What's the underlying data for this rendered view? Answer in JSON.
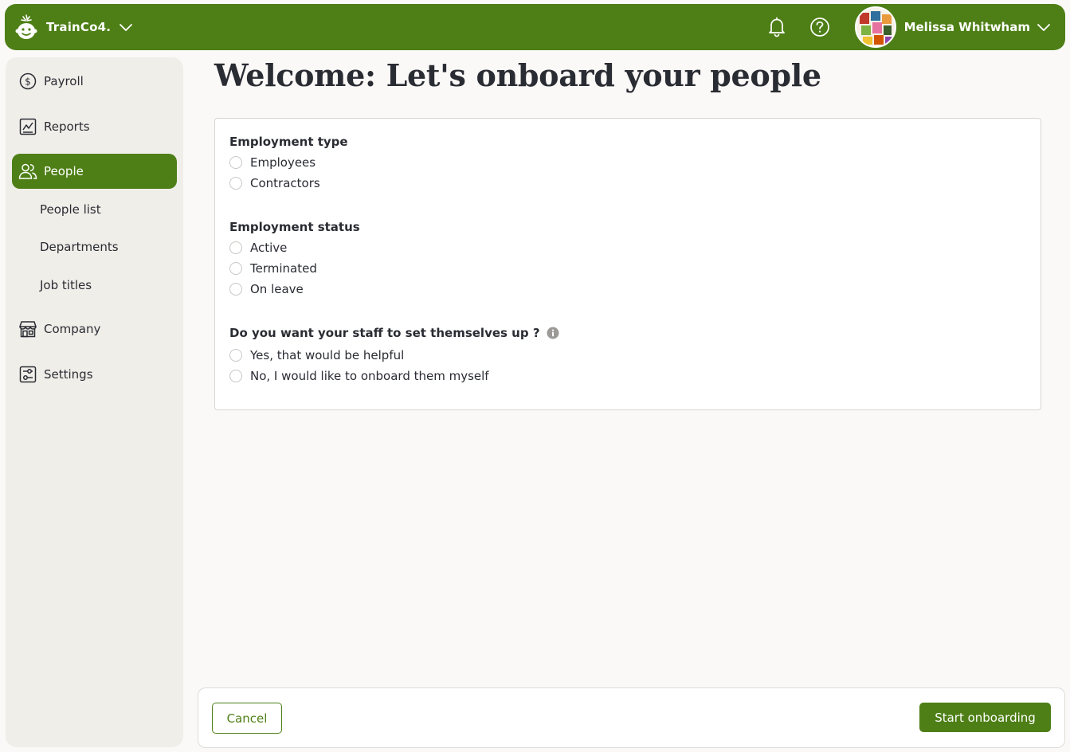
{
  "header": {
    "company_name": "TrainCo4.",
    "user_name": "Melissa Whitwham",
    "icons": [
      "bell-icon",
      "help-icon",
      "chevron-down-icon"
    ]
  },
  "sidebar": {
    "items": [
      {
        "label": "Payroll",
        "icon": "dollar-circle-icon"
      },
      {
        "label": "Reports",
        "icon": "chart-icon"
      },
      {
        "label": "People",
        "icon": "people-icon",
        "active": true
      },
      {
        "label": "Company",
        "icon": "storefront-icon"
      },
      {
        "label": "Settings",
        "icon": "sliders-icon"
      }
    ],
    "people_subitems": [
      "People list",
      "Departments",
      "Job titles"
    ]
  },
  "main": {
    "title": "Welcome: Let's onboard your people",
    "groups": [
      {
        "label": "Employment type",
        "options": [
          "Employees",
          "Contractors"
        ]
      },
      {
        "label": "Employment status",
        "options": [
          "Active",
          "Terminated",
          "On leave"
        ]
      },
      {
        "label": "Do you want your staff to set themselves up ?",
        "options": [
          "Yes, that would be helpful",
          "No, I would like to onboard them myself"
        ]
      }
    ]
  },
  "footer": {
    "cancel_label": "Cancel",
    "start_label": "Start onboarding"
  },
  "colors": {
    "brand_green": "#4e7f16",
    "sidebar_bg": "#f0eee9",
    "page_bg": "#faf9f7"
  }
}
